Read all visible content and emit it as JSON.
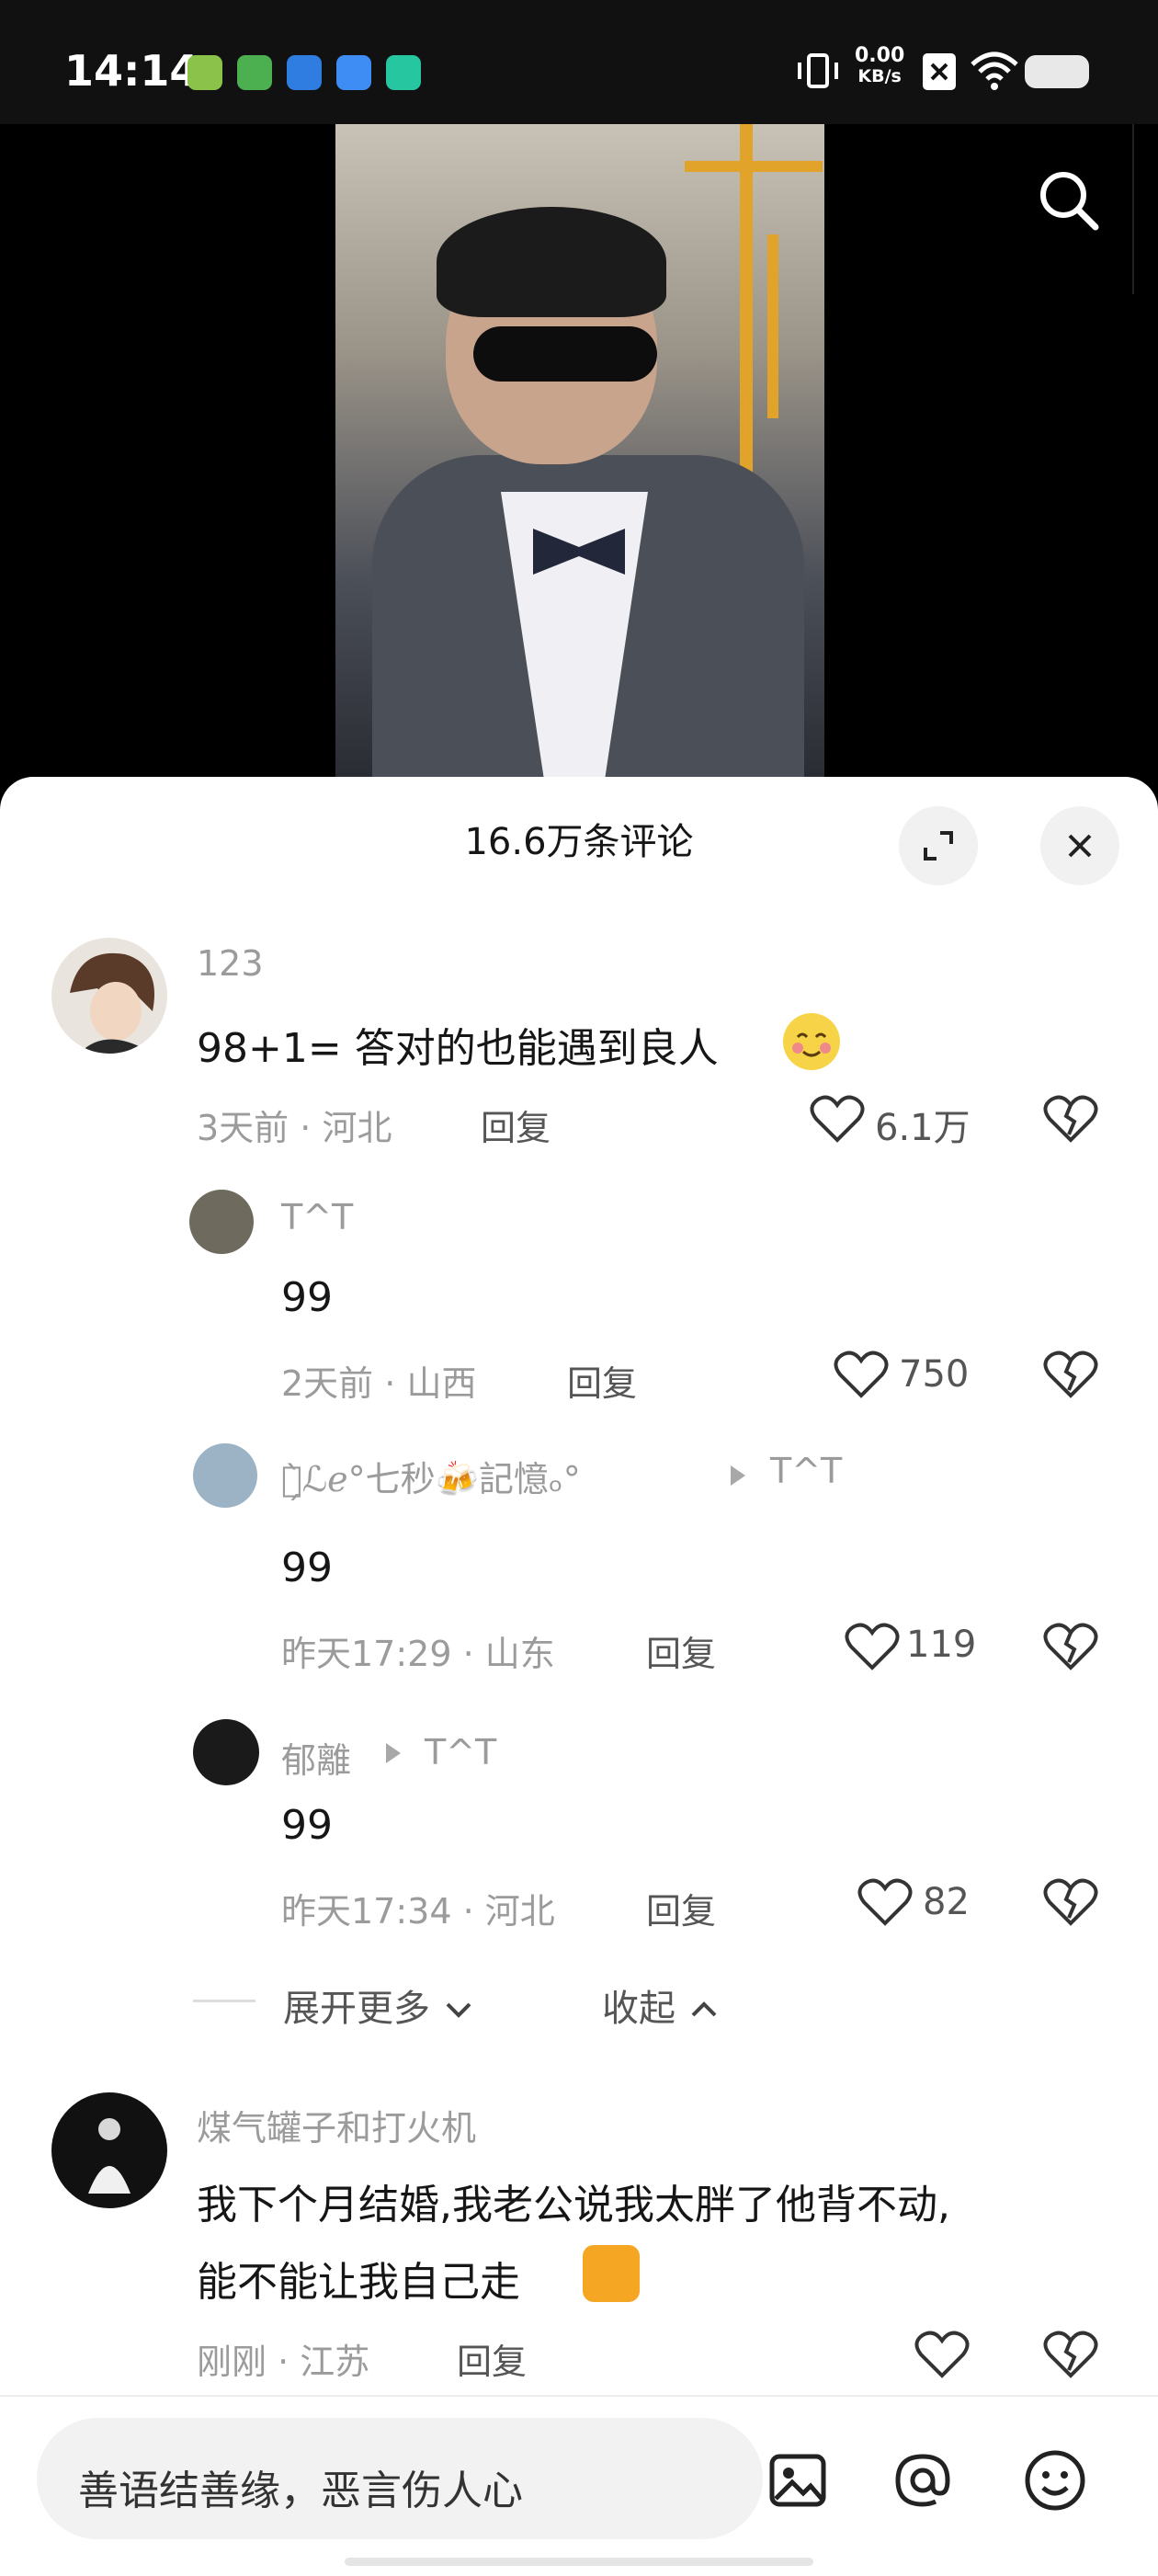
{
  "status_bar": {
    "time": "14:14",
    "net_speed_value": "0.00",
    "net_speed_unit": "KB/s",
    "icons": [
      "vibrate-icon",
      "sim-off-icon",
      "wifi-icon",
      "battery-icon"
    ],
    "app_icons": [
      "green-check-app-icon",
      "green-app-icon",
      "blue-app-icon",
      "blue-pill-app-icon",
      "teal-shield-app-icon"
    ]
  },
  "header": {
    "comment_count": "16.6万条评论"
  },
  "comments": [
    {
      "user": "123",
      "text": "98+1= 答对的也能遇到良人",
      "emoji": "smiling-blush-emoji",
      "time": "3天前",
      "location": "河北",
      "reply_label": "回复",
      "likes": "6.1万"
    },
    {
      "user": "T^T",
      "text": "99",
      "time": "2天前",
      "location": "山西",
      "reply_label": "回复",
      "likes": "750"
    },
    {
      "user": "ｰ̗̀ℒℯ°七秒🍻記憶ₒ°",
      "reply_to": "T^T",
      "text": "99",
      "time": "昨天17:29",
      "location": "山东",
      "reply_label": "回复",
      "likes": "119"
    },
    {
      "user": "郁離",
      "reply_to": "T^T",
      "text": "99",
      "time": "昨天17:34",
      "location": "河北",
      "reply_label": "回复",
      "likes": "82"
    },
    {
      "user": "煤气罐子和打火机",
      "text_line1": "我下个月结婚,我老公说我太胖了他背不动,",
      "text_line2": "能不能让我自己走",
      "emoji": "bear-emoji",
      "time": "刚刚",
      "location": "江苏",
      "reply_label": "回复"
    }
  ],
  "thread_controls": {
    "expand_more": "展开更多",
    "collapse": "收起"
  },
  "input": {
    "placeholder": "善语结善缘，恶言伤人心"
  },
  "colors": {
    "accent_video_pole": "#e2a32a",
    "sheet_bg": "#ffffff",
    "secondary_text": "#9b9b9b"
  }
}
